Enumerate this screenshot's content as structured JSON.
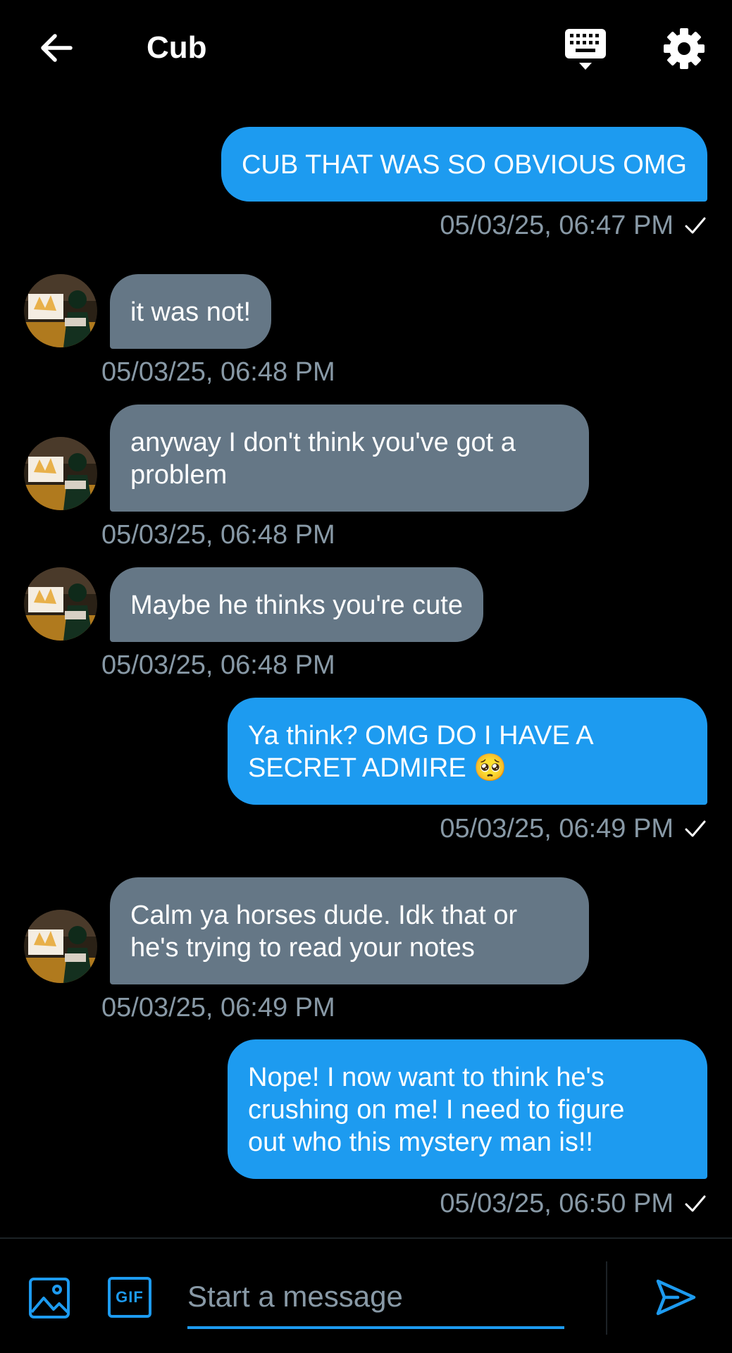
{
  "header": {
    "title": "Cub",
    "icons": [
      "back-arrow-icon",
      "keyboard-icon",
      "gear-icon"
    ]
  },
  "messages": [
    {
      "direction": "sent",
      "lines": [
        "CUB THAT WAS SO OBVIOUS OMG"
      ],
      "timestamp": "05/03/25, 06:47 PM",
      "status": "sent-check"
    },
    {
      "direction": "received",
      "lines": [
        "it was not!"
      ],
      "timestamp": "05/03/25, 06:48 PM"
    },
    {
      "direction": "received",
      "lines": [
        "anyway I don't think you've got a",
        "problem"
      ],
      "timestamp": "05/03/25, 06:48 PM"
    },
    {
      "direction": "received",
      "lines": [
        "Maybe he thinks you're cute"
      ],
      "timestamp": "05/03/25, 06:48 PM"
    },
    {
      "direction": "sent",
      "lines": [
        "Ya think? OMG DO I HAVE A",
        "SECRET ADMIRE 🥺"
      ],
      "timestamp": "05/03/25, 06:49 PM",
      "status": "sent-check"
    },
    {
      "direction": "received",
      "lines": [
        "Calm ya horses dude. Idk that or",
        "he's trying to read your notes"
      ],
      "timestamp": "05/03/25, 06:49 PM"
    },
    {
      "direction": "sent",
      "lines": [
        "Nope! I now want to think he's",
        "crushing on me! I need to figure",
        "out who this mystery man is!!"
      ],
      "timestamp": "05/03/25, 06:50 PM",
      "status": "sent-check"
    }
  ],
  "composer": {
    "gif_label": "GIF",
    "placeholder": "Start a message",
    "value": "",
    "icons": [
      "image-icon",
      "gif-icon",
      "send-icon"
    ]
  },
  "colors": {
    "background": "#000000",
    "sent_bubble": "#1d9bf0",
    "received_bubble": "#657786",
    "timestamp": "#8899a6",
    "accent": "#1d9bf0"
  }
}
